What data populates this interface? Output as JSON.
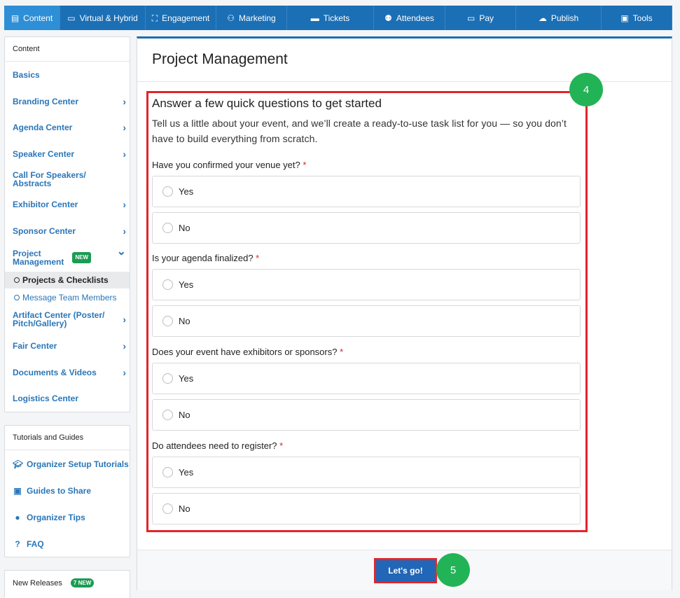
{
  "topnav": [
    {
      "label": "Content",
      "icon": "list-icon",
      "glyph": "▤",
      "active": true,
      "w": 80
    },
    {
      "label": "Virtual & Hybrid",
      "icon": "laptop-icon",
      "glyph": "▭",
      "w": 122
    },
    {
      "label": "Engagement",
      "icon": "network-icon",
      "glyph": "⛶",
      "w": 101
    },
    {
      "label": "Marketing",
      "icon": "share-icon",
      "glyph": "⚇",
      "w": 101
    },
    {
      "label": "Tickets",
      "icon": "ticket-icon",
      "glyph": "▬",
      "w": 124
    },
    {
      "label": "Attendees",
      "icon": "users-icon",
      "glyph": "⚉",
      "w": 102
    },
    {
      "label": "Pay",
      "icon": "card-icon",
      "glyph": "▭",
      "w": 101
    },
    {
      "label": "Publish",
      "icon": "cloud-upload-icon",
      "glyph": "☁",
      "w": 122
    },
    {
      "label": "Tools",
      "icon": "briefcase-icon",
      "glyph": "▣",
      "w": 101
    }
  ],
  "sidebar": {
    "heading": "Content",
    "items": {
      "basics": "Basics",
      "branding": "Branding Center",
      "agenda": "Agenda Center",
      "speaker": "Speaker Center",
      "cfs_line1": "Call For Speakers/",
      "cfs_line2": "Abstracts",
      "exhibitor": "Exhibitor Center",
      "sponsor": "Sponsor Center",
      "pm_line1": "Project",
      "pm_line2": "Management",
      "pm_badge": "NEW",
      "projects": "Projects & Checklists",
      "message": "Message Team Members",
      "artifact_line1": "Artifact Center (Poster/",
      "artifact_line2": "Pitch/Gallery)",
      "fair": "Fair Center",
      "documents": "Documents & Videos",
      "logistics": "Logistics Center"
    },
    "chevron": "›",
    "chevron_down": "⌄"
  },
  "tutorials": {
    "heading": "Tutorials and Guides",
    "items": [
      "Organizer Setup Tutorials",
      "Guides to Share",
      "Organizer Tips",
      "FAQ"
    ]
  },
  "releases": {
    "heading": "New Releases",
    "badge": "7 NEW"
  },
  "main": {
    "title": "Project Management",
    "heading": "Answer a few quick questions to get started",
    "description": "Tell us a little about your event, and we’ll create a ready-to-use task list for you — so you don’t have to build everything from scratch.",
    "required_mark": "*",
    "questions": [
      {
        "label": "Have you confirmed your venue yet?",
        "options": [
          "Yes",
          "No"
        ]
      },
      {
        "label": "Is your agenda finalized?",
        "options": [
          "Yes",
          "No"
        ]
      },
      {
        "label": "Does your event have exhibitors or sponsors?",
        "options": [
          "Yes",
          "No"
        ]
      },
      {
        "label": "Do attendees need to register?",
        "options": [
          "Yes",
          "No"
        ]
      }
    ],
    "submit_label": "Let's go!"
  },
  "annotations": {
    "step4": "4",
    "step5": "5"
  }
}
